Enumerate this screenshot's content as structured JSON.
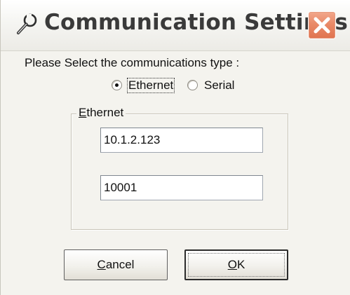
{
  "window": {
    "title": "Communication Settings",
    "title_icon": "wrench-icon",
    "close_icon": "close-icon"
  },
  "prompt": "Please Select the communications type :",
  "comm_type": {
    "options": [
      {
        "label": "Ethernet",
        "selected": true
      },
      {
        "label": "Serial",
        "selected": false
      }
    ]
  },
  "ethernet_group": {
    "legend_mnemonic": "E",
    "legend_rest": "thernet",
    "ip_address": "10.1.2.123",
    "port": "10001"
  },
  "buttons": {
    "cancel_mnemonic": "C",
    "cancel_rest": "ancel",
    "ok_mnemonic": "O",
    "ok_rest": "K"
  },
  "colors": {
    "close_button": "#e0734f",
    "dialog_background": "#f4f3ee"
  }
}
